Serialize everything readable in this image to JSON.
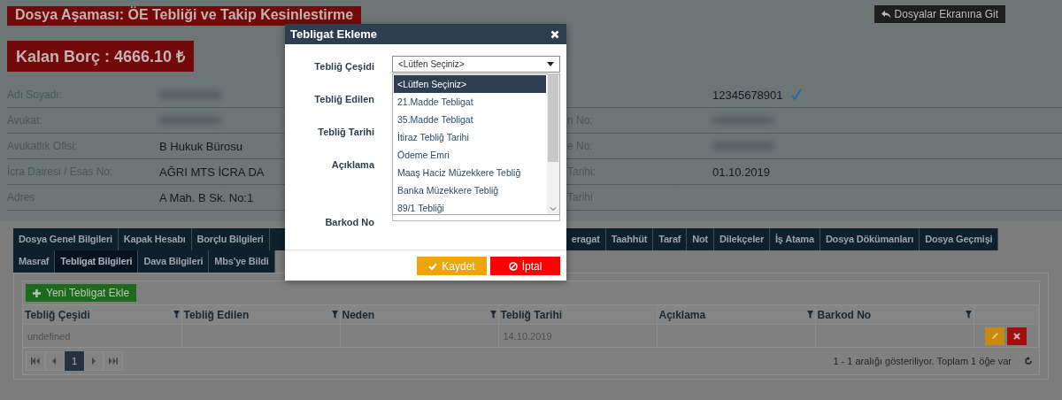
{
  "header": {
    "stage_title": "Dosya Aşaması: ÖE Tebliği ve Takip Kesinlestirme",
    "back_button": "Dosyalar Ekranına Git",
    "remaining_debt": "Kalan Borç : 4666.10 ₺"
  },
  "details": [
    {
      "left": {
        "label": "Adı Soyadı:",
        "kind": "redacted"
      },
      "right": {
        "value": "12345678901",
        "kind": "text",
        "verified": true
      }
    },
    {
      "left": {
        "label": "Avukat:",
        "kind": "redacted"
      },
      "right": {
        "label": "n No:",
        "kind": "redacted"
      }
    },
    {
      "left": {
        "label": "Avukatlık Ofisi:",
        "value": "B Hukuk Bürosu",
        "kind": "text"
      },
      "right": {
        "label": "e No:",
        "kind": "redacted"
      }
    },
    {
      "left": {
        "label": "İcra Dairesi / Esas No:",
        "value": "AĞRI MTS İCRA DA",
        "kind": "text"
      },
      "right": {
        "label": "Tarihi:",
        "value": "01.10.2019",
        "kind": "text"
      }
    },
    {
      "left": {
        "label": "Adres",
        "value": "A Mah. B Sk. No:1",
        "kind": "text"
      },
      "right": {
        "label": "Tarihi",
        "kind": "empty"
      }
    }
  ],
  "tabs": [
    [
      {
        "label": "Dosya Genel Bilgileri",
        "selected": false
      },
      {
        "label": "Kapak Hesabı",
        "selected": false
      },
      {
        "label": "Borçlu Bilgileri",
        "selected": false
      },
      {
        "label": "eragat",
        "selected": false,
        "kind": "cut"
      },
      {
        "label": "Taahhüt",
        "selected": false
      },
      {
        "label": "Taraf",
        "selected": false
      },
      {
        "label": "Not",
        "selected": false
      },
      {
        "label": "Dilekçeler",
        "selected": false
      },
      {
        "label": "İş Atama",
        "selected": false
      },
      {
        "label": "Dosya Dökümanları",
        "selected": false
      },
      {
        "label": "Dosya Geçmişi",
        "selected": false
      }
    ],
    [
      {
        "label": "Masraf",
        "selected": false
      },
      {
        "label": "Tebligat Bilgileri",
        "selected": true
      },
      {
        "label": "Dava Bilgileri",
        "selected": false
      },
      {
        "label": "Mbs'ye Bildi",
        "selected": false,
        "kind": "cut"
      }
    ]
  ],
  "grid": {
    "add_button": "Yeni Tebligat Ekle",
    "columns": [
      {
        "title": "Tebliğ Çeşidi",
        "filterable": true
      },
      {
        "title": "Tebliğ Edilen",
        "filterable": true
      },
      {
        "title": "Neden",
        "filterable": true
      },
      {
        "title": "Tebliğ Tarihi",
        "filterable": false
      },
      {
        "title": "Açıklama",
        "filterable": true
      },
      {
        "title": "Barkod No",
        "filterable": true
      }
    ],
    "rows": [
      {
        "cells": [
          "undefined",
          null,
          null,
          "14.10.2019",
          null,
          null
        ]
      }
    ],
    "pager": {
      "current_page": "1",
      "status": "1 - 1 aralığı gösteriliyor. Toplam 1 öğe var"
    }
  },
  "modal": {
    "title": "Tebligat Ekleme",
    "fields": [
      {
        "label": "Tebliğ Çeşidi",
        "kind": "select",
        "value": "<Lütfen Seçiniz>"
      },
      {
        "label": "Tebliğ Edilen",
        "kind": "covered"
      },
      {
        "label": "Tebliğ Tarihi",
        "kind": "covered"
      },
      {
        "label": "Açıklama",
        "kind": "textarea"
      },
      {
        "label": "Barkod No",
        "kind": "input"
      }
    ],
    "dropdown": [
      {
        "label": "<Lütfen Seçiniz>",
        "selected": true
      },
      {
        "label": "21.Madde Tebligat",
        "selected": false
      },
      {
        "label": "35.Madde Tebligat",
        "selected": false
      },
      {
        "label": "İtiraz Tebliğ Tarihi",
        "selected": false
      },
      {
        "label": "Ödeme Emri",
        "selected": false
      },
      {
        "label": "Maaş Haciz Müzekkere Tebliğ",
        "selected": false
      },
      {
        "label": "Banka Müzekkere Tebliğ",
        "selected": false
      },
      {
        "label": "89/1 Tebliği",
        "selected": false
      }
    ],
    "buttons": [
      {
        "label": "Kaydet",
        "kind": "save"
      },
      {
        "label": "İptal",
        "kind": "cancel"
      }
    ]
  }
}
